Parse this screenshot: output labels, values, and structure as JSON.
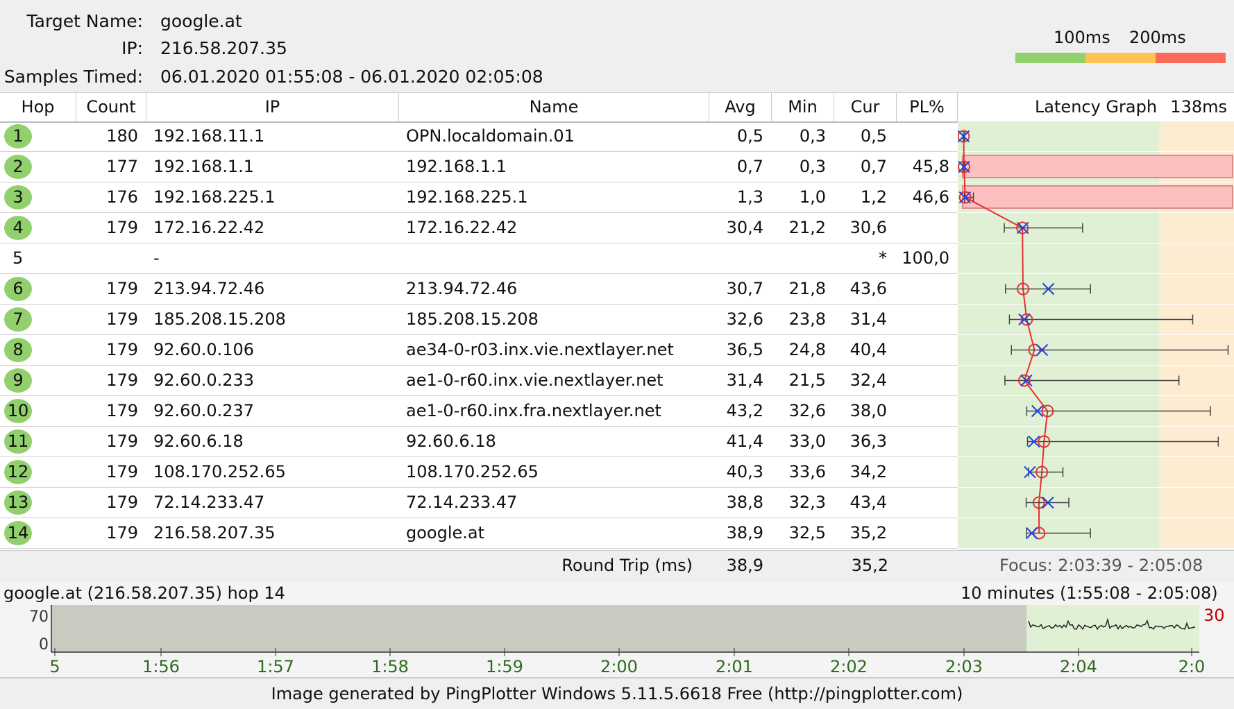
{
  "header": {
    "target_name_label": "Target Name:",
    "target_name": "google.at",
    "ip_label": "IP:",
    "ip": "216.58.207.35",
    "samples_label": "Samples Timed:",
    "samples": "06.01.2020 01:55:08 - 06.01.2020 02:05:08",
    "legend_100": "100ms",
    "legend_200": "200ms",
    "colors": {
      "good": "#92d06e",
      "warn": "#fdc451",
      "bad": "#fd6a57"
    }
  },
  "columns": {
    "hop": "Hop",
    "count": "Count",
    "ip": "IP",
    "name": "Name",
    "avg": "Avg",
    "min": "Min",
    "cur": "Cur",
    "pl": "PL%",
    "graph": "Latency Graph",
    "graph_max": "138ms"
  },
  "hops": [
    {
      "hop": "1",
      "count": "180",
      "ip": "192.168.11.1",
      "name": "OPN.localdomain.01",
      "avg": "0,5",
      "min": "0,3",
      "cur": "0,5",
      "pl": "",
      "ok": true
    },
    {
      "hop": "2",
      "count": "177",
      "ip": "192.168.1.1",
      "name": "192.168.1.1",
      "avg": "0,7",
      "min": "0,3",
      "cur": "0,7",
      "pl": "45,8",
      "ok": true
    },
    {
      "hop": "3",
      "count": "176",
      "ip": "192.168.225.1",
      "name": "192.168.225.1",
      "avg": "1,3",
      "min": "1,0",
      "cur": "1,2",
      "pl": "46,6",
      "ok": true
    },
    {
      "hop": "4",
      "count": "179",
      "ip": "172.16.22.42",
      "name": "172.16.22.42",
      "avg": "30,4",
      "min": "21,2",
      "cur": "30,6",
      "pl": "",
      "ok": true
    },
    {
      "hop": "5",
      "count": "",
      "ip": "-",
      "name": "",
      "avg": "",
      "min": "",
      "cur": "*",
      "pl": "100,0",
      "ok": false
    },
    {
      "hop": "6",
      "count": "179",
      "ip": "213.94.72.46",
      "name": "213.94.72.46",
      "avg": "30,7",
      "min": "21,8",
      "cur": "43,6",
      "pl": "",
      "ok": true
    },
    {
      "hop": "7",
      "count": "179",
      "ip": "185.208.15.208",
      "name": "185.208.15.208",
      "avg": "32,6",
      "min": "23,8",
      "cur": "31,4",
      "pl": "",
      "ok": true
    },
    {
      "hop": "8",
      "count": "179",
      "ip": "92.60.0.106",
      "name": "ae34-0-r03.inx.vie.nextlayer.net",
      "avg": "36,5",
      "min": "24,8",
      "cur": "40,4",
      "pl": "",
      "ok": true
    },
    {
      "hop": "9",
      "count": "179",
      "ip": "92.60.0.233",
      "name": "ae1-0-r60.inx.vie.nextlayer.net",
      "avg": "31,4",
      "min": "21,5",
      "cur": "32,4",
      "pl": "",
      "ok": true
    },
    {
      "hop": "10",
      "count": "179",
      "ip": "92.60.0.237",
      "name": "ae1-0-r60.inx.fra.nextlayer.net",
      "avg": "43,2",
      "min": "32,6",
      "cur": "38,0",
      "pl": "",
      "ok": true
    },
    {
      "hop": "11",
      "count": "179",
      "ip": "92.60.6.18",
      "name": "92.60.6.18",
      "avg": "41,4",
      "min": "33,0",
      "cur": "36,3",
      "pl": "",
      "ok": true
    },
    {
      "hop": "12",
      "count": "179",
      "ip": "108.170.252.65",
      "name": "108.170.252.65",
      "avg": "40,3",
      "min": "33,6",
      "cur": "34,2",
      "pl": "",
      "ok": true
    },
    {
      "hop": "13",
      "count": "179",
      "ip": "72.14.233.47",
      "name": "72.14.233.47",
      "avg": "38,8",
      "min": "32,3",
      "cur": "43,4",
      "pl": "",
      "ok": true
    },
    {
      "hop": "14",
      "count": "179",
      "ip": "216.58.207.35",
      "name": "google.at",
      "avg": "38,9",
      "min": "32,5",
      "cur": "35,2",
      "pl": "",
      "ok": true
    }
  ],
  "latency_graph": {
    "max_ms": 138,
    "green_until_ms": 100,
    "min_ms": [
      0.3,
      0.3,
      1.0,
      21.2,
      null,
      21.8,
      23.8,
      24.8,
      21.5,
      32.6,
      33.0,
      33.6,
      32.3,
      32.5
    ],
    "avg_ms": [
      0.5,
      0.7,
      1.3,
      30.4,
      null,
      30.7,
      32.6,
      36.5,
      31.4,
      43.2,
      41.4,
      40.3,
      38.8,
      38.9
    ],
    "cur_ms": [
      0.5,
      0.7,
      1.2,
      30.6,
      null,
      43.6,
      31.4,
      40.4,
      32.4,
      38.0,
      36.3,
      34.2,
      43.4,
      35.2
    ],
    "max_ms_per_hop": [
      1.0,
      1.2,
      5.5,
      61.0,
      null,
      65.0,
      117.0,
      135.0,
      110.0,
      126.0,
      130.0,
      51.0,
      54.0,
      65.0
    ],
    "packet_loss": [
      0,
      45.8,
      46.6,
      0,
      100,
      0,
      0,
      0,
      0,
      0,
      0,
      0,
      0,
      0
    ]
  },
  "round_trip": {
    "label": "Round Trip (ms)",
    "avg": "38,9",
    "cur": "35,2",
    "focus": "Focus: 2:03:39 - 2:05:08"
  },
  "timeline": {
    "left_label": "google.at (216.58.207.35) hop 14",
    "right_label": "10 minutes (1:55:08 - 2:05:08)",
    "y_max": "70",
    "y_min": "0",
    "current": "30",
    "ticks": [
      "5",
      "1:56",
      "1:57",
      "1:58",
      "1:59",
      "2:00",
      "2:01",
      "2:02",
      "2:03",
      "2:04",
      "2:0"
    ]
  },
  "footer": "Image generated by PingPlotter Windows 5.11.5.6618 Free (http://pingplotter.com)"
}
